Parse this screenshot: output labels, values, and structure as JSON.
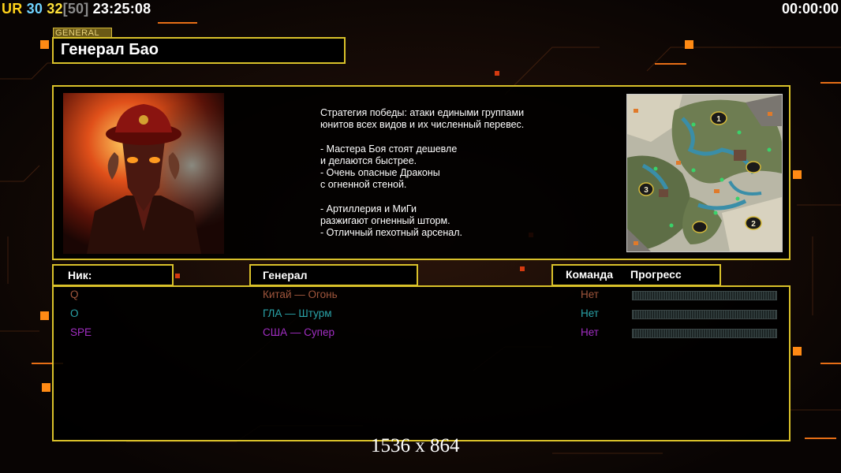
{
  "hud": {
    "ur_label": "UR",
    "num_a": "30",
    "num_b": "32",
    "num_c": "[50]",
    "time": "23:25:08",
    "elapsed": "00:00:00"
  },
  "header": {
    "tag": "GENERAL",
    "title": "Генерал Бао"
  },
  "description": [
    "Стратегия победы: атаки едиными группами",
    "юнитов всех видов и их численный перевес.",
    "",
    "- Мастера Боя стоят дешевле",
    "и делаются быстрее.",
    "- Очень опасные Драконы",
    "с огненной стеной.",
    "",
    "- Артиллерия и МиГи",
    "разжигают огненный шторм.",
    "- Отличный пехотный арсенал."
  ],
  "minimap": {
    "start_positions": [
      "1",
      "2",
      "3"
    ]
  },
  "columns": {
    "nick": "Ник:",
    "general": "Генерал",
    "team": "Команда",
    "progress": "Прогресс"
  },
  "players": [
    {
      "nick": "Q",
      "general": "Китай — Огонь",
      "team": "Нет",
      "color": "#a0563c",
      "progress": 0
    },
    {
      "nick": "O",
      "general": "ГЛА — Штурм",
      "team": "Нет",
      "color": "#2aa3a8",
      "progress": 0
    },
    {
      "nick": "SPE",
      "general": "США — Супер",
      "team": "Нет",
      "color": "#a12ec2",
      "progress": 0
    }
  ],
  "resolution": "1536 x 864",
  "colors": {
    "frame": "#d9c12a",
    "ur": "#ffd21a",
    "num_a": "#6fd3ff",
    "num_b": "#ffe23a",
    "num_c": "#8a8a8a"
  }
}
